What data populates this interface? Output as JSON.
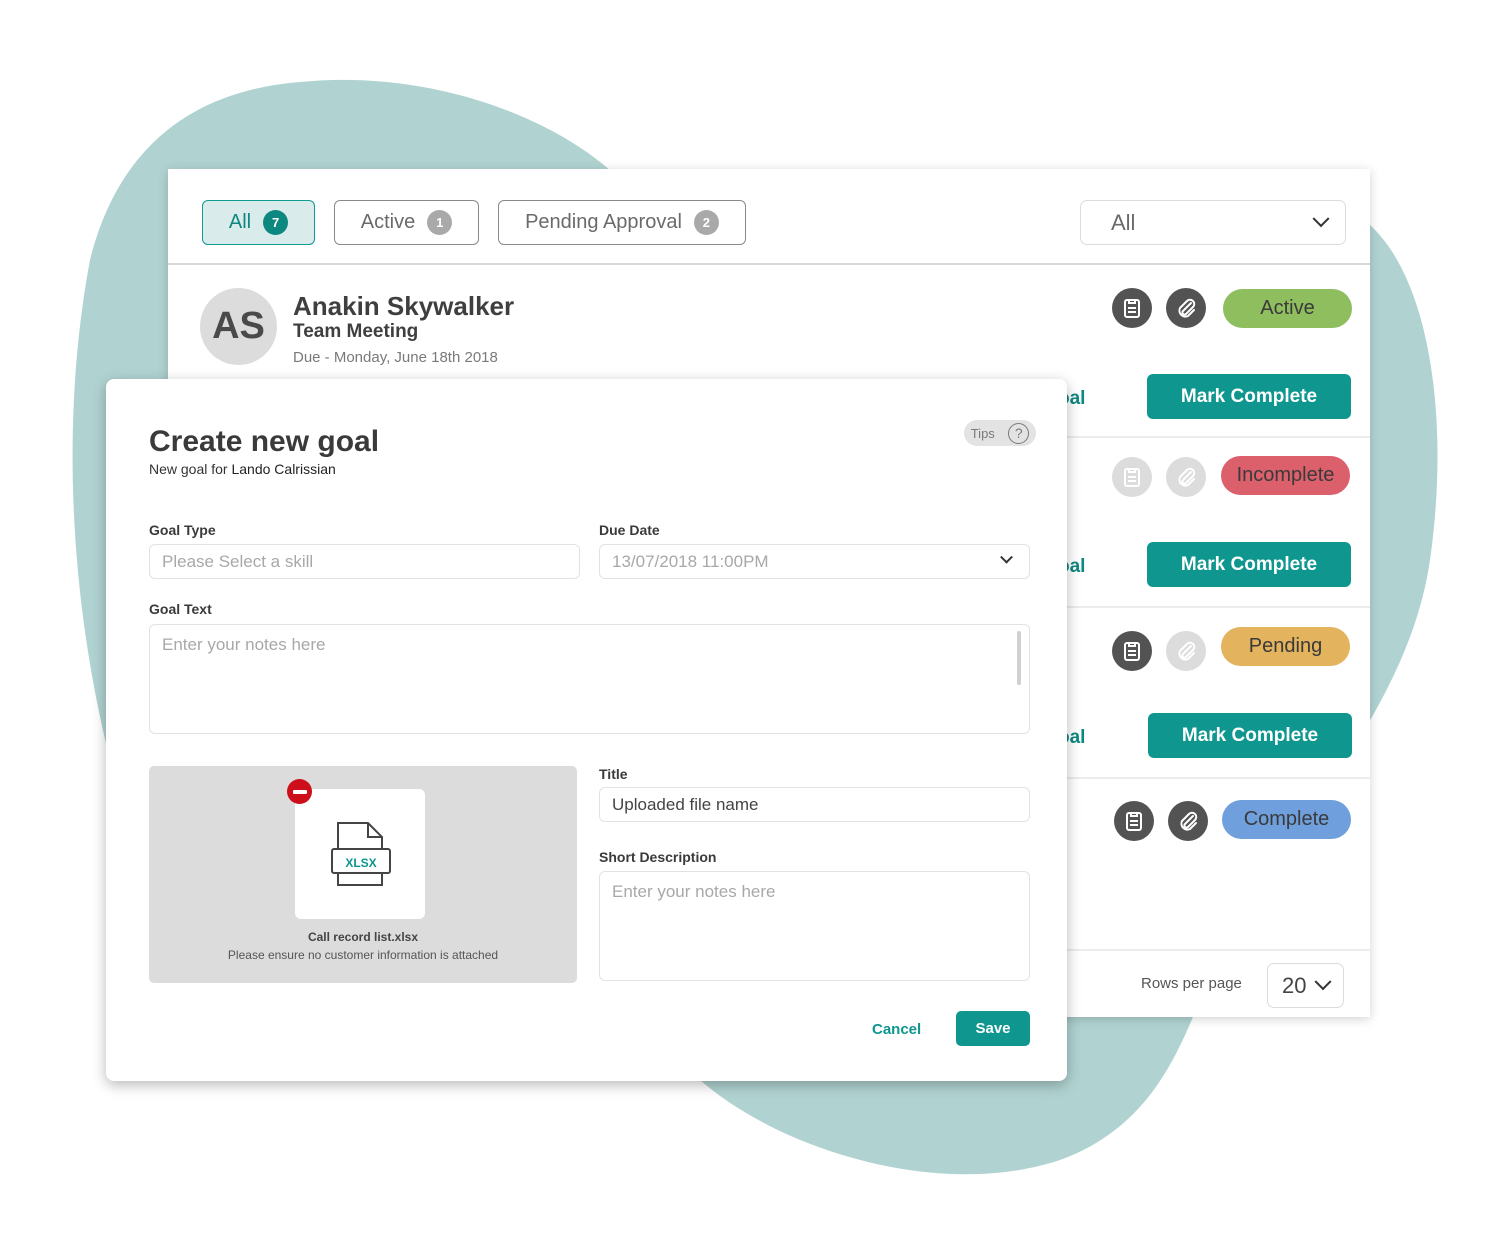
{
  "colors": {
    "brand_teal": "#0f968f",
    "blob": "#b0d3d1",
    "status_active": "#8fbe5f",
    "status_incomplete": "#dc5f6c",
    "status_pending": "#e3b35e",
    "status_complete": "#6f9fdc",
    "remove_red": "#cc0f1b"
  },
  "filters": {
    "tabs": [
      {
        "label": "All",
        "count": "7",
        "selected": true
      },
      {
        "label": "Active",
        "count": "1",
        "selected": false
      },
      {
        "label": "Pending Approval",
        "count": "2",
        "selected": false
      }
    ],
    "dropdown_value": "All"
  },
  "list": {
    "person": {
      "initials": "AS",
      "name": "Anakin Skywalker",
      "goal": "Team Meeting",
      "due": "Due  - Monday, June 18th 2018"
    },
    "partial_link_text": "oal",
    "rows": [
      {
        "status": "Active",
        "notes_icon": "enabled",
        "attach_icon": "enabled",
        "action": "Mark Complete"
      },
      {
        "status": "Incomplete",
        "notes_icon": "disabled",
        "attach_icon": "disabled",
        "action": "Mark Complete"
      },
      {
        "status": "Pending",
        "notes_icon": "enabled",
        "attach_icon": "disabled",
        "action": "Mark Complete"
      },
      {
        "status": "Complete",
        "notes_icon": "enabled",
        "attach_icon": "enabled"
      }
    ],
    "pagination": {
      "rows_per_page_label": "Rows per page",
      "rows_per_page_value": "20"
    }
  },
  "modal": {
    "title": "Create new goal",
    "subtitle_prefix": "New goal for ",
    "subtitle_person": "Lando Calrissian",
    "tips_label": "Tips",
    "goal_type": {
      "label": "Goal Type",
      "placeholder": "Please Select a skill"
    },
    "due_date": {
      "label": "Due Date",
      "value": "13/07/2018 11:00PM"
    },
    "goal_text": {
      "label": "Goal Text",
      "placeholder": "Enter your notes here"
    },
    "attachment": {
      "file_type": "XLSX",
      "file_name": "Call record list.xlsx",
      "note": "Please ensure no customer information is attached"
    },
    "title_field": {
      "label": "Title",
      "value": "Uploaded file name"
    },
    "short_description": {
      "label": "Short Description",
      "placeholder": "Enter your notes here"
    },
    "cancel_label": "Cancel",
    "save_label": "Save"
  }
}
